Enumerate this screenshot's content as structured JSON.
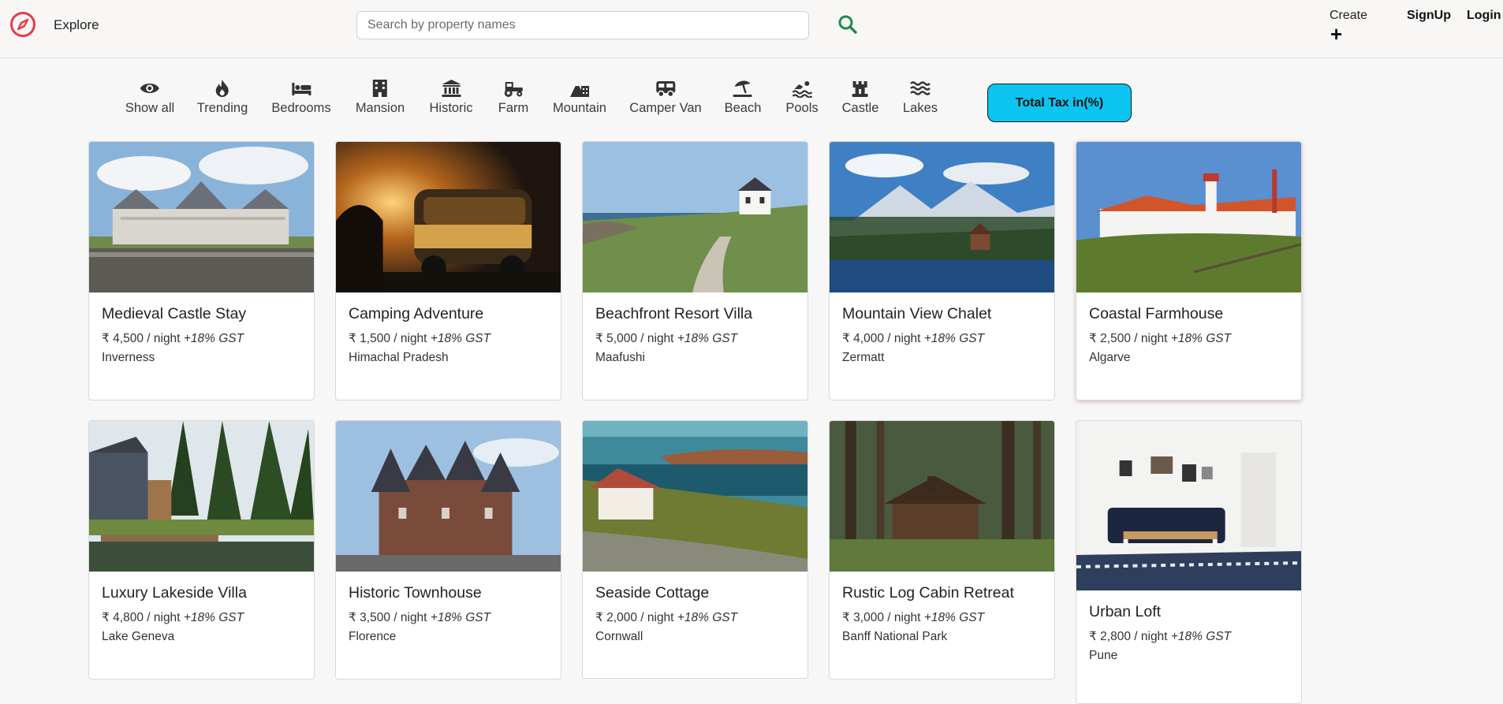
{
  "nav": {
    "explore_label": "Explore",
    "search_placeholder": "Search by property names",
    "create_label": "Create",
    "create_plus": "+",
    "signup_label": "SignUp",
    "login_label": "Login",
    "brand_color": "#e8394a",
    "search_icon_color": "#1f8a4c"
  },
  "filters": [
    {
      "label": "Show all",
      "icon": "eye-icon"
    },
    {
      "label": "Trending",
      "icon": "fire-icon"
    },
    {
      "label": "Bedrooms",
      "icon": "bed-icon"
    },
    {
      "label": "Mansion",
      "icon": "building-icon"
    },
    {
      "label": "Historic",
      "icon": "landmark-icon"
    },
    {
      "label": "Farm",
      "icon": "tractor-icon"
    },
    {
      "label": "Mountain",
      "icon": "mountain-city-icon"
    },
    {
      "label": "Camper Van",
      "icon": "van-icon"
    },
    {
      "label": "Beach",
      "icon": "umbrella-beach-icon"
    },
    {
      "label": "Pools",
      "icon": "swimmer-icon"
    },
    {
      "label": "Castle",
      "icon": "chess-rook-icon"
    },
    {
      "label": "Lakes",
      "icon": "water-icon"
    }
  ],
  "tax_toggle": {
    "label": "Total Tax in(%)",
    "color": "#0bc4ef"
  },
  "listings": [
    {
      "title": "Medieval Castle Stay",
      "price": "₹ 4,500 / night",
      "gst": "+18% GST",
      "location": "Inverness"
    },
    {
      "title": "Camping Adventure",
      "price": "₹ 1,500 / night",
      "gst": "+18% GST",
      "location": "Himachal Pradesh"
    },
    {
      "title": "Beachfront Resort Villa",
      "price": "₹ 5,000 / night",
      "gst": "+18% GST",
      "location": "Maafushi"
    },
    {
      "title": "Mountain View Chalet",
      "price": "₹ 4,000 / night",
      "gst": "+18% GST",
      "location": "Zermatt"
    },
    {
      "title": "Coastal Farmhouse",
      "price": "₹ 2,500 / night",
      "gst": "+18% GST",
      "location": "Algarve"
    },
    {
      "title": "Luxury Lakeside Villa",
      "price": "₹ 4,800 / night",
      "gst": "+18% GST",
      "location": "Lake Geneva"
    },
    {
      "title": "Historic Townhouse",
      "price": "₹ 3,500 / night",
      "gst": "+18% GST",
      "location": "Florence"
    },
    {
      "title": "Seaside Cottage",
      "price": "₹ 2,000 / night",
      "gst": "+18% GST",
      "location": "Cornwall"
    },
    {
      "title": "Rustic Log Cabin Retreat",
      "price": "₹ 3,000 / night",
      "gst": "+18% GST",
      "location": "Banff National Park"
    },
    {
      "title": "Urban Loft",
      "price": "₹ 2,800 / night",
      "gst": "+18% GST",
      "location": "Pune"
    }
  ]
}
